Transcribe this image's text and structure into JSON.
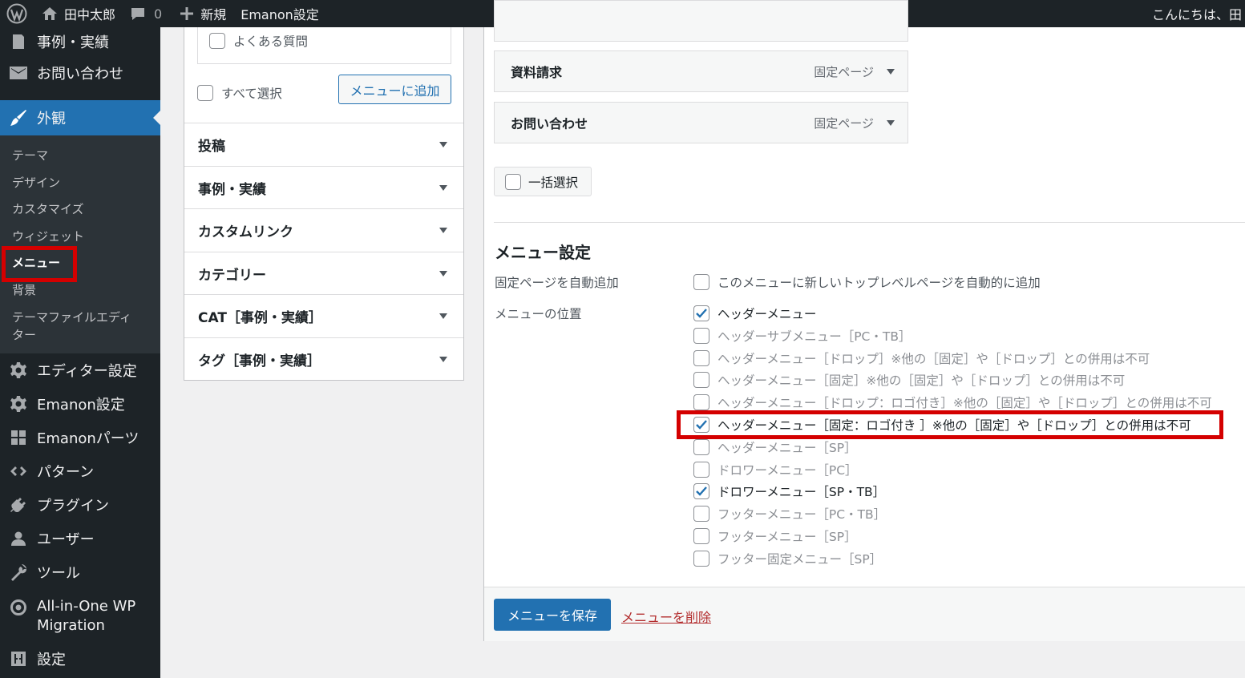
{
  "adminbar": {
    "site_name": "田中太郎",
    "comments_count": "0",
    "new_label": "新規",
    "emanon_settings": "Emanon設定",
    "greeting": "こんにちは、田"
  },
  "sidebar": {
    "items_top": [
      {
        "label": "事例・実績",
        "icon": "pin-icon"
      },
      {
        "label": "お問い合わせ",
        "icon": "mail-icon"
      }
    ],
    "current": {
      "label": "外観",
      "icon": "paintbrush-icon"
    },
    "submenu": [
      "テーマ",
      "デザイン",
      "カスタマイズ",
      "ウィジェット",
      "メニュー",
      "背景",
      "テーマファイルエディター"
    ],
    "items_bottom": [
      {
        "label": "エディター設定",
        "icon": "gear-icon"
      },
      {
        "label": "Emanon設定",
        "icon": "gear-icon"
      },
      {
        "label": "Emanonパーツ",
        "icon": "grid-icon"
      },
      {
        "label": "パターン",
        "icon": "diamond-icon"
      },
      {
        "label": "プラグイン",
        "icon": "plug-icon"
      },
      {
        "label": "ユーザー",
        "icon": "user-icon"
      },
      {
        "label": "ツール",
        "icon": "wrench-icon"
      },
      {
        "label": "All-in-One WP Migration",
        "icon": "migration-icon"
      },
      {
        "label": "設定",
        "icon": "settings-icon"
      }
    ]
  },
  "left_panel": {
    "faq_label": "よくある質問",
    "select_all": "すべて選択",
    "add_to_menu": "メニューに追加",
    "accordion": [
      "投稿",
      "事例・実績",
      "カスタムリンク",
      "カテゴリー",
      "CAT［事例・実績］",
      "タグ［事例・実績］"
    ]
  },
  "menu_items": [
    {
      "title": "資料請求",
      "type": "固定ページ"
    },
    {
      "title": "お問い合わせ",
      "type": "固定ページ"
    }
  ],
  "bulk_select": "一括選択",
  "menu_settings": {
    "title": "メニュー設定",
    "auto_add_label": "固定ページを自動追加",
    "auto_add_option": "このメニューに新しいトップレベルページを自動的に追加",
    "location_label": "メニューの位置",
    "locations": [
      {
        "label": "ヘッダーメニュー",
        "checked": true
      },
      {
        "label": "ヘッダーサブメニュー［PC・TB］",
        "checked": false
      },
      {
        "label": "ヘッダーメニュー［ドロップ］※他の［固定］や［ドロップ］との併用は不可",
        "checked": false
      },
      {
        "label": "ヘッダーメニュー［固定］※他の［固定］や［ドロップ］との併用は不可",
        "checked": false
      },
      {
        "label": "ヘッダーメニュー［ドロップ：ロゴ付き］※他の［固定］や［ドロップ］との併用は不可",
        "checked": false
      },
      {
        "label": "ヘッダーメニュー［固定：ロゴ付き ］※他の［固定］や［ドロップ］との併用は不可",
        "checked": true
      },
      {
        "label": "ヘッダーメニュー［SP］",
        "checked": false
      },
      {
        "label": "ドロワーメニュー［PC］",
        "checked": false
      },
      {
        "label": "ドロワーメニュー［SP・TB］",
        "checked": true
      },
      {
        "label": "フッターメニュー［PC・TB］",
        "checked": false
      },
      {
        "label": "フッターメニュー［SP］",
        "checked": false
      },
      {
        "label": "フッター固定メニュー［SP］",
        "checked": false
      }
    ]
  },
  "footer": {
    "save": "メニューを保存",
    "delete": "メニューを削除"
  },
  "colors": {
    "admin_dark": "#1d2327",
    "accent_blue": "#2271b1",
    "highlight_red": "#d40000",
    "delete_red": "#b32d2e"
  }
}
